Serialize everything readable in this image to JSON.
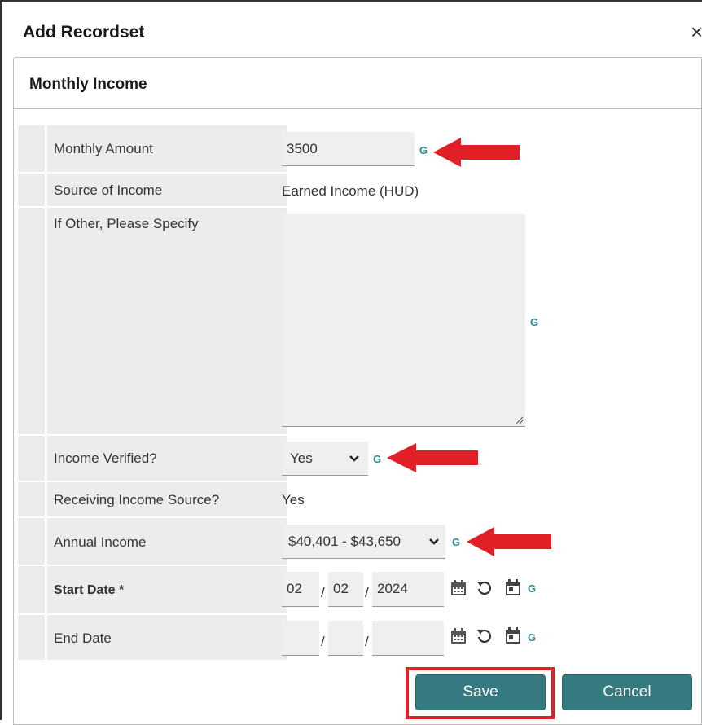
{
  "dialog": {
    "title": "Add Recordset",
    "close_glyph": "×"
  },
  "panel": {
    "title": "Monthly Income"
  },
  "fields": {
    "monthly_amount": {
      "label": "Monthly Amount",
      "value": "3500"
    },
    "source_of_income": {
      "label": "Source of Income",
      "value": "Earned Income (HUD)"
    },
    "if_other": {
      "label": "If Other, Please Specify",
      "value": ""
    },
    "income_verified": {
      "label": "Income Verified?",
      "value": "Yes"
    },
    "receiving_income_source": {
      "label": "Receiving Income Source?",
      "value": "Yes"
    },
    "annual_income": {
      "label": "Annual Income",
      "value": "$40,401 - $43,650"
    },
    "start_date": {
      "label": "Start Date",
      "required_mark": "*",
      "month": "02",
      "day": "02",
      "year": "2024"
    },
    "end_date": {
      "label": "End Date",
      "month": "",
      "day": "",
      "year": ""
    }
  },
  "g_label": "G",
  "date_sep": "/",
  "buttons": {
    "save": "Save",
    "cancel": "Cancel"
  },
  "colors": {
    "accent": "#357a80",
    "g_link": "#2e8a93",
    "annotation": "#e01f26"
  }
}
